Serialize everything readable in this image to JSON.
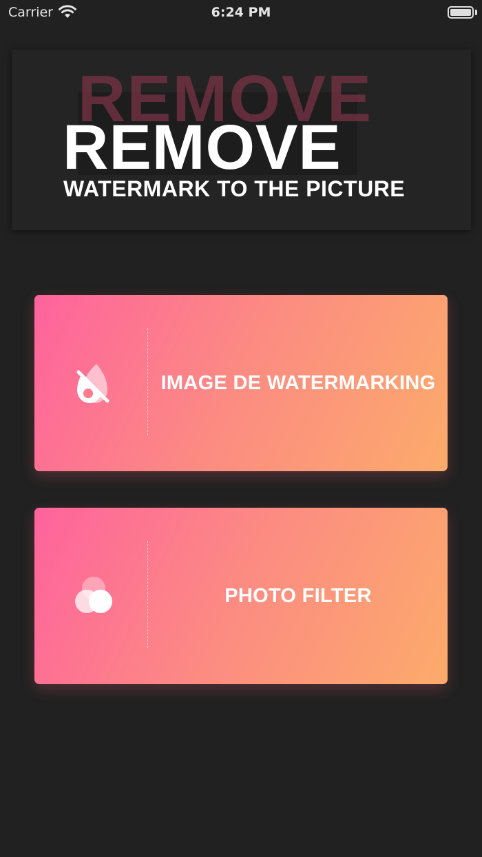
{
  "status_bar": {
    "carrier": "Carrier",
    "time": "6:24 PM",
    "wifi_icon": "wifi-icon",
    "battery_icon": "battery-icon"
  },
  "banner": {
    "ghost_text": "REMOVE",
    "title": "REMOVE",
    "subtitle": "WATERMARK TO THE PICTURE"
  },
  "actions": [
    {
      "label": "IMAGE DE WATERMARKING",
      "icon": "drop-slash-icon"
    },
    {
      "label": "PHOTO FILTER",
      "icon": "filter-circles-icon"
    }
  ],
  "colors": {
    "background": "#212121",
    "banner_bg": "#242424",
    "gradient_start": "#fe639d",
    "gradient_end": "#fcab6b",
    "ghost_text": "#7a3346"
  }
}
